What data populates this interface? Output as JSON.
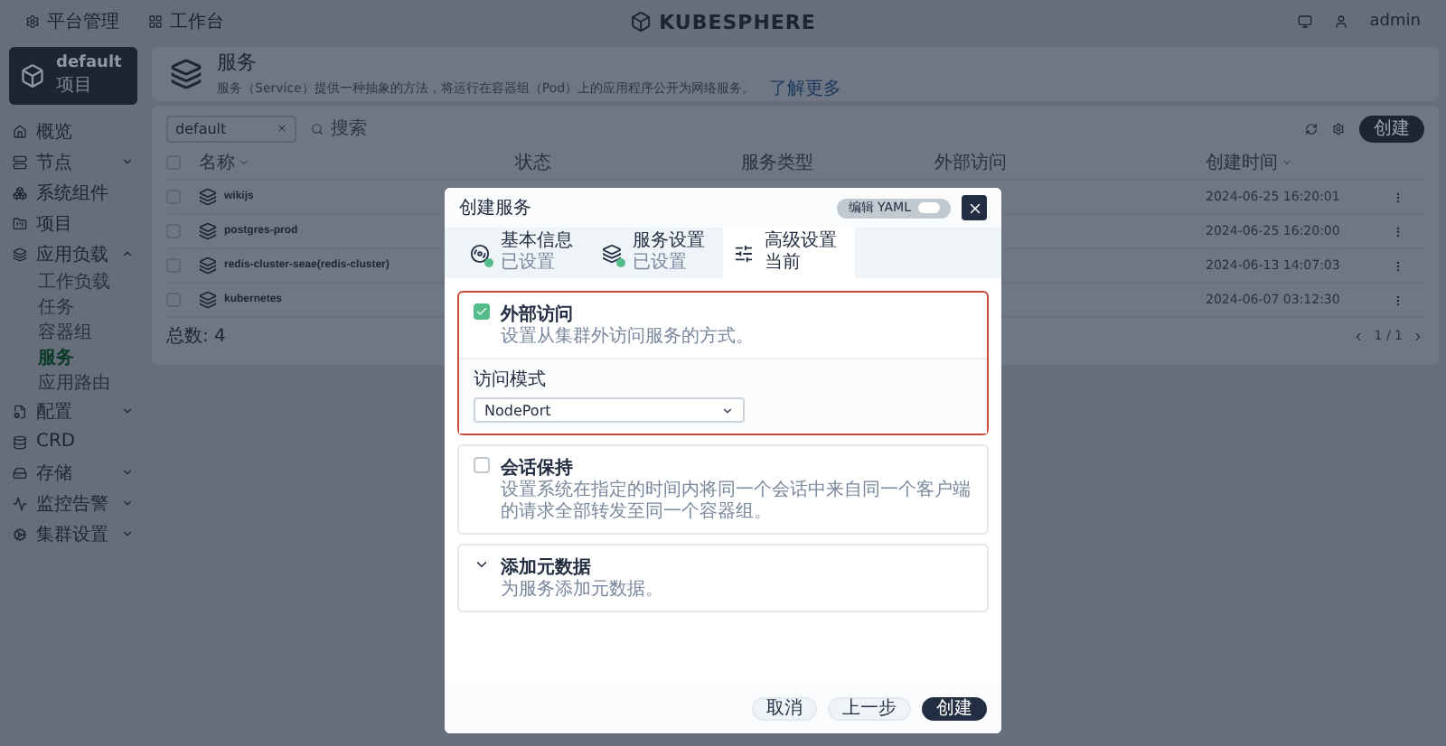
{
  "top_bar": {
    "nav": [
      "平台管理",
      "工作台"
    ],
    "logo": "KUBESPHERE",
    "user": "admin"
  },
  "workspace": {
    "name": "default",
    "type": "项目"
  },
  "sidebar": {
    "items": [
      {
        "label": "概览",
        "selected": false
      },
      {
        "label": "节点",
        "selected": false,
        "expanded": false
      },
      {
        "label": "系统组件",
        "selected": false
      },
      {
        "label": "项目",
        "selected": false
      },
      {
        "label": "应用负载",
        "selected": false,
        "expanded": true,
        "children": [
          {
            "label": "工作负载",
            "selected": false
          },
          {
            "label": "任务",
            "selected": false
          },
          {
            "label": "容器组",
            "selected": false
          },
          {
            "label": "服务",
            "selected": true
          },
          {
            "label": "应用路由",
            "selected": false
          }
        ]
      },
      {
        "label": "配置",
        "selected": false,
        "expanded": false
      },
      {
        "label": "CRD",
        "selected": false
      },
      {
        "label": "存储",
        "selected": false,
        "expanded": false
      },
      {
        "label": "监控告警",
        "selected": false,
        "expanded": false
      },
      {
        "label": "集群设置",
        "selected": false,
        "expanded": false
      }
    ]
  },
  "header": {
    "title": "服务",
    "description": "服务（Service）提供一种抽象的方法，将运行在容器组（Pod）上的应用程序公开为网络服务。",
    "link": "了解更多"
  },
  "toolbar": {
    "filter": "default",
    "search_placeholder": "搜索",
    "create_button": "创建"
  },
  "table": {
    "all_selected": false,
    "columns": [
      {
        "label": "名称",
        "sortable": true
      },
      {
        "label": "状态",
        "sortable": false
      },
      {
        "label": "服务类型",
        "sortable": false
      },
      {
        "label": "外部访问",
        "sortable": false
      },
      {
        "label": "创建时间",
        "sortable": true
      }
    ],
    "rows": [
      {
        "name": "wikijs",
        "created": "2024-06-25 16:20:01",
        "selected": false
      },
      {
        "name": "postgres-prod",
        "created": "2024-06-25 16:20:00",
        "selected": false
      },
      {
        "name": "redis-cluster-seae(redis-cluster)",
        "created": "2024-06-13 14:07:03",
        "selected": false
      },
      {
        "name": "kubernetes",
        "created": "2024-06-07 03:12:30",
        "selected": false
      }
    ],
    "total": "总数: 4",
    "pagination": "1 / 1"
  },
  "dialog": {
    "title": "创建服务",
    "yaml_toggle": {
      "label": "编辑 YAML",
      "on": false
    },
    "steps": [
      {
        "title": "基本信息",
        "status_text": "已设置",
        "selected": false
      },
      {
        "title": "服务设置",
        "status_text": "已设置",
        "selected": false
      },
      {
        "title": "高级设置",
        "status_text": "当前",
        "selected": true
      }
    ],
    "sections": [
      {
        "kind": "checkbox",
        "title": "外部访问",
        "description": "设置从集群外访问服务的方式。",
        "checked": true,
        "highlighted": true,
        "field": {
          "label": "访问模式",
          "value": "NodePort"
        }
      },
      {
        "kind": "checkbox",
        "title": "会话保持",
        "description": "设置系统在指定的时间内将同一个会话中来自同一个客户端的请求全部转发至同一个容器组。",
        "checked": false,
        "highlighted": false
      },
      {
        "kind": "expander",
        "title": "添加元数据",
        "description": "为服务添加元数据。",
        "expanded": false,
        "highlighted": false
      }
    ],
    "buttons": [
      {
        "label": "取消",
        "kind": "secondary"
      },
      {
        "label": "上一步",
        "kind": "secondary"
      },
      {
        "label": "创建",
        "kind": "primary"
      }
    ]
  }
}
